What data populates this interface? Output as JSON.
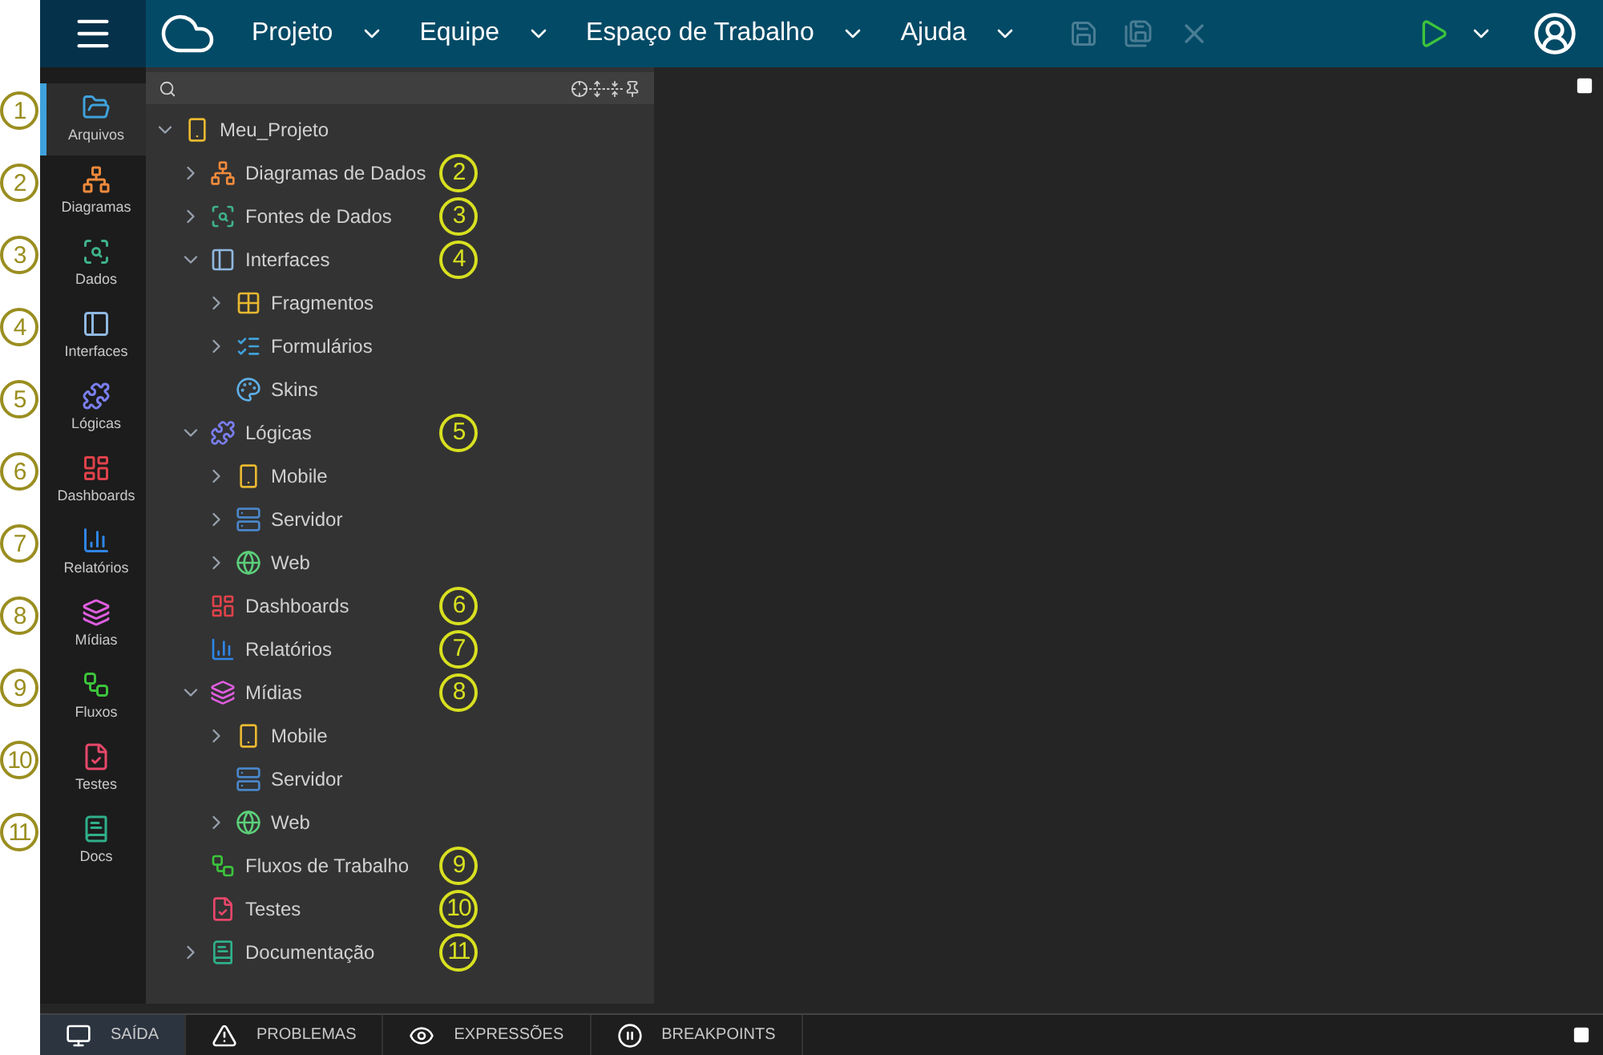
{
  "menu": [
    {
      "label": "Projeto"
    },
    {
      "label": "Equipe"
    },
    {
      "label": "Espaço de Trabalho"
    },
    {
      "label": "Ajuda"
    }
  ],
  "sidebar": [
    {
      "label": "Arquivos",
      "kind": "folder",
      "color": "#3fa2dc",
      "selected": true,
      "callout": "1"
    },
    {
      "label": "Diagramas",
      "kind": "diagram",
      "color": "#f08a3c",
      "selected": false,
      "callout": "2"
    },
    {
      "label": "Dados",
      "kind": "data",
      "color": "#3fb38a",
      "selected": false,
      "callout": "3"
    },
    {
      "label": "Interfaces",
      "kind": "interface",
      "color": "#8fb8e0",
      "selected": false,
      "callout": "4"
    },
    {
      "label": "Lógicas",
      "kind": "puzzle",
      "color": "#7b7ff0",
      "selected": false,
      "callout": "5"
    },
    {
      "label": "Dashboards",
      "kind": "dashboard",
      "color": "#e0424a",
      "selected": false,
      "callout": "6"
    },
    {
      "label": "Relatórios",
      "kind": "report",
      "color": "#2f86e8",
      "selected": false,
      "callout": "7"
    },
    {
      "label": "Mídias",
      "kind": "layers",
      "color": "#e05ee0",
      "selected": false,
      "callout": "8"
    },
    {
      "label": "Fluxos",
      "kind": "flow",
      "color": "#3cc43c",
      "selected": false,
      "callout": "9"
    },
    {
      "label": "Testes",
      "kind": "test",
      "color": "#e8476a",
      "selected": false,
      "callout": "10"
    },
    {
      "label": "Docs",
      "kind": "doc",
      "color": "#2fb08a",
      "selected": false,
      "callout": "11"
    }
  ],
  "tree": {
    "label": "Meu_Projeto",
    "kind": "mobile",
    "color": "#e8b830",
    "expanded": true,
    "children": [
      {
        "label": "Diagramas de Dados",
        "kind": "diagram",
        "color": "#f08a3c",
        "expanded": false,
        "callout": "2"
      },
      {
        "label": "Fontes de Dados",
        "kind": "data",
        "color": "#3fb38a",
        "expanded": false,
        "callout": "3"
      },
      {
        "label": "Interfaces",
        "kind": "interface",
        "color": "#8fb8e0",
        "expanded": true,
        "callout": "4",
        "children": [
          {
            "label": "Fragmentos",
            "kind": "fragments",
            "color": "#e8b830",
            "expanded": false
          },
          {
            "label": "Formulários",
            "kind": "form",
            "color": "#3fa2dc",
            "expanded": false
          },
          {
            "label": "Skins",
            "kind": "palette",
            "color": "#5fb0e8"
          }
        ]
      },
      {
        "label": "Lógicas",
        "kind": "puzzle",
        "color": "#7b7ff0",
        "expanded": true,
        "callout": "5",
        "children": [
          {
            "label": "Mobile",
            "kind": "mobile",
            "color": "#e8b830",
            "expanded": false
          },
          {
            "label": "Servidor",
            "kind": "server",
            "color": "#4a86c8",
            "expanded": false
          },
          {
            "label": "Web",
            "kind": "web",
            "color": "#5ccf7a",
            "expanded": false
          }
        ]
      },
      {
        "label": "Dashboards",
        "kind": "dashboard",
        "color": "#e0424a",
        "callout": "6"
      },
      {
        "label": "Relatórios",
        "kind": "report",
        "color": "#2f86e8",
        "callout": "7"
      },
      {
        "label": "Mídias",
        "kind": "layers",
        "color": "#e05ee0",
        "expanded": true,
        "callout": "8",
        "children": [
          {
            "label": "Mobile",
            "kind": "mobile",
            "color": "#e8b830",
            "expanded": false
          },
          {
            "label": "Servidor",
            "kind": "server",
            "color": "#4a86c8"
          },
          {
            "label": "Web",
            "kind": "web",
            "color": "#5ccf7a",
            "expanded": false
          }
        ]
      },
      {
        "label": "Fluxos de Trabalho",
        "kind": "flow",
        "color": "#3cc43c",
        "callout": "9"
      },
      {
        "label": "Testes",
        "kind": "test",
        "color": "#e8476a",
        "callout": "10"
      },
      {
        "label": "Documentação",
        "kind": "doc",
        "color": "#2fb08a",
        "expanded": false,
        "callout": "11"
      }
    ]
  },
  "bottom_tabs": [
    {
      "label": "SAÍDA",
      "kind": "output",
      "selected": true
    },
    {
      "label": "PROBLEMAS",
      "kind": "warning",
      "selected": false
    },
    {
      "label": "EXPRESSÕES",
      "kind": "eye",
      "selected": false
    },
    {
      "label": "BREAKPOINTS",
      "kind": "pause",
      "selected": false
    }
  ]
}
